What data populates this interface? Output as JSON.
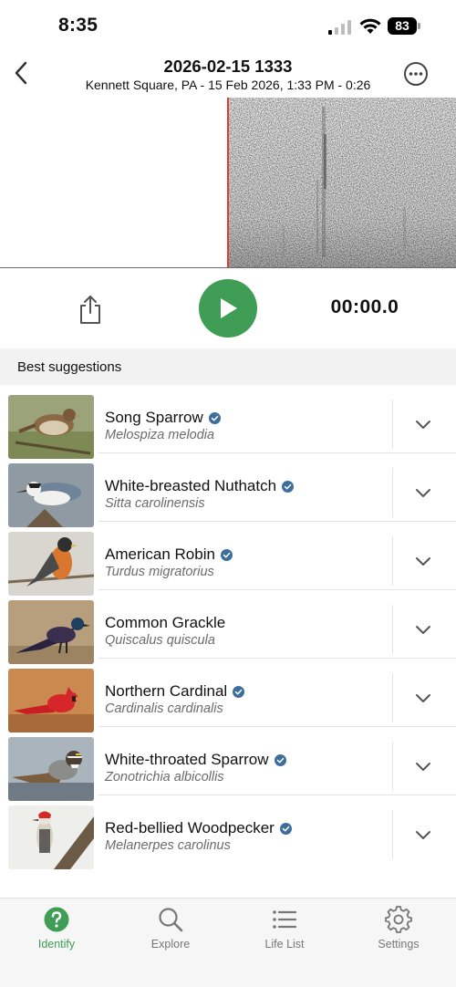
{
  "status_bar": {
    "time": "8:35",
    "battery": "83"
  },
  "header": {
    "title": "2026-02-15 1333",
    "subtitle": "Kennett Square, PA - 15 Feb 2026, 1:33 PM - 0:26"
  },
  "player": {
    "timer": "00:00.0"
  },
  "section": {
    "title": "Best suggestions"
  },
  "suggestions": [
    {
      "common": "Song Sparrow",
      "scientific": "Melospiza melodia",
      "verified": true
    },
    {
      "common": "White-breasted Nuthatch",
      "scientific": "Sitta carolinensis",
      "verified": true
    },
    {
      "common": "American Robin",
      "scientific": "Turdus migratorius",
      "verified": true
    },
    {
      "common": "Common Grackle",
      "scientific": "Quiscalus quiscula",
      "verified": false
    },
    {
      "common": "Northern Cardinal",
      "scientific": "Cardinalis cardinalis",
      "verified": true
    },
    {
      "common": "White-throated Sparrow",
      "scientific": "Zonotrichia albicollis",
      "verified": true
    },
    {
      "common": "Red-bellied Woodpecker",
      "scientific": "Melanerpes carolinus",
      "verified": true
    }
  ],
  "tabs": [
    {
      "label": "Identify",
      "icon": "question-circle-icon",
      "active": true
    },
    {
      "label": "Explore",
      "icon": "search-icon",
      "active": false
    },
    {
      "label": "Life List",
      "icon": "list-icon",
      "active": false
    },
    {
      "label": "Settings",
      "icon": "gear-icon",
      "active": false
    }
  ],
  "colors": {
    "accent": "#3f9d55",
    "playhead": "#e23a2e",
    "verified": "#3d6e9c"
  }
}
